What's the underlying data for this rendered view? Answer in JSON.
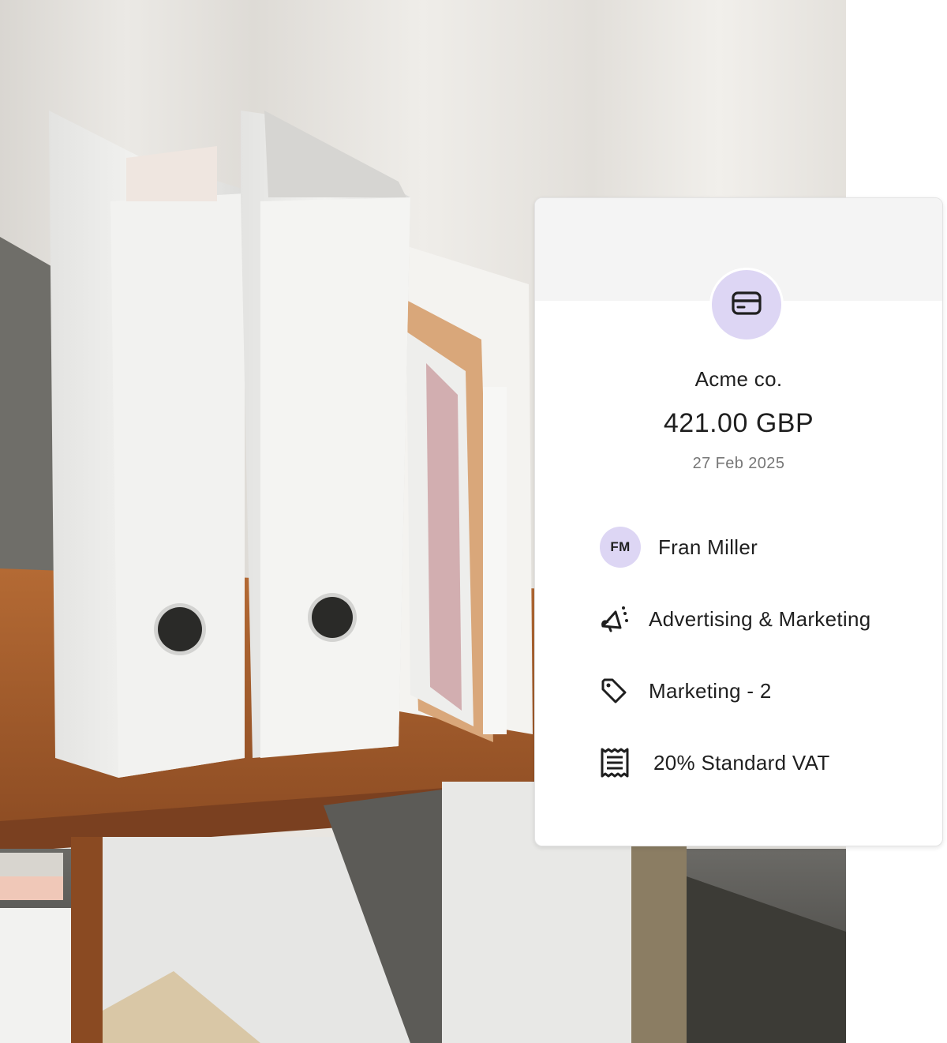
{
  "card": {
    "merchant": "Acme co.",
    "amount": "421.00 GBP",
    "date": "27 Feb 2025",
    "card_icon": "credit-card-icon",
    "details": {
      "user_initials": "FM",
      "user_name": "Fran Miller",
      "category_icon": "megaphone-icon",
      "category": "Advertising & Marketing",
      "tag_icon": "tag-icon",
      "tag": "Marketing - 2",
      "tax_icon": "receipt-icon",
      "tax": "20% Standard VAT"
    },
    "accent_color": "#ddd6f4"
  },
  "photo": {
    "subject": "white binders and paper folders on a wooden shelf"
  }
}
